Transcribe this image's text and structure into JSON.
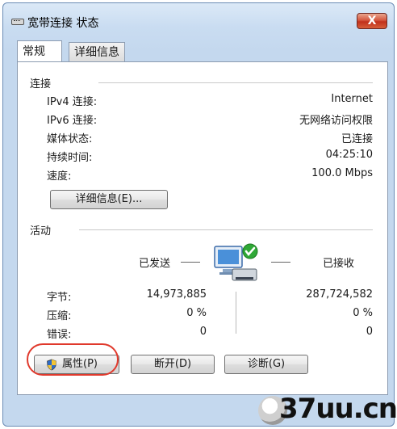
{
  "window": {
    "title": "宽带连接 状态",
    "close_label": "X"
  },
  "tabs": [
    {
      "label": "常规",
      "active": true
    },
    {
      "label": "详细信息",
      "active": false
    }
  ],
  "connection": {
    "section_label": "连接",
    "rows": [
      {
        "label": "IPv4 连接:",
        "value": "Internet"
      },
      {
        "label": "IPv6 连接:",
        "value": "无网络访问权限"
      },
      {
        "label": "媒体状态:",
        "value": "已连接"
      },
      {
        "label": "持续时间:",
        "value": "04:25:10"
      },
      {
        "label": "速度:",
        "value": "100.0 Mbps"
      }
    ],
    "details_button": "详细信息(E)..."
  },
  "activity": {
    "section_label": "活动",
    "sent_label": "已发送",
    "received_label": "已接收",
    "rows": [
      {
        "label": "字节:",
        "sent": "14,973,885",
        "received": "287,724,582"
      },
      {
        "label": "压缩:",
        "sent": "0 %",
        "received": "0 %"
      },
      {
        "label": "错误:",
        "sent": "0",
        "received": "0"
      }
    ]
  },
  "buttons": {
    "properties": "属性(P)",
    "disconnect": "断开(D)",
    "diagnose": "诊断(G)"
  },
  "watermark": {
    "text": "37uu.cn"
  },
  "icons": {
    "title": "network-adapter-icon",
    "activity": "network-computers-icon",
    "properties": "uac-shield-icon"
  },
  "colors": {
    "close_red": "#c1311c",
    "highlight_ring": "#e0392c",
    "window_blue": "#c4d8ee"
  }
}
